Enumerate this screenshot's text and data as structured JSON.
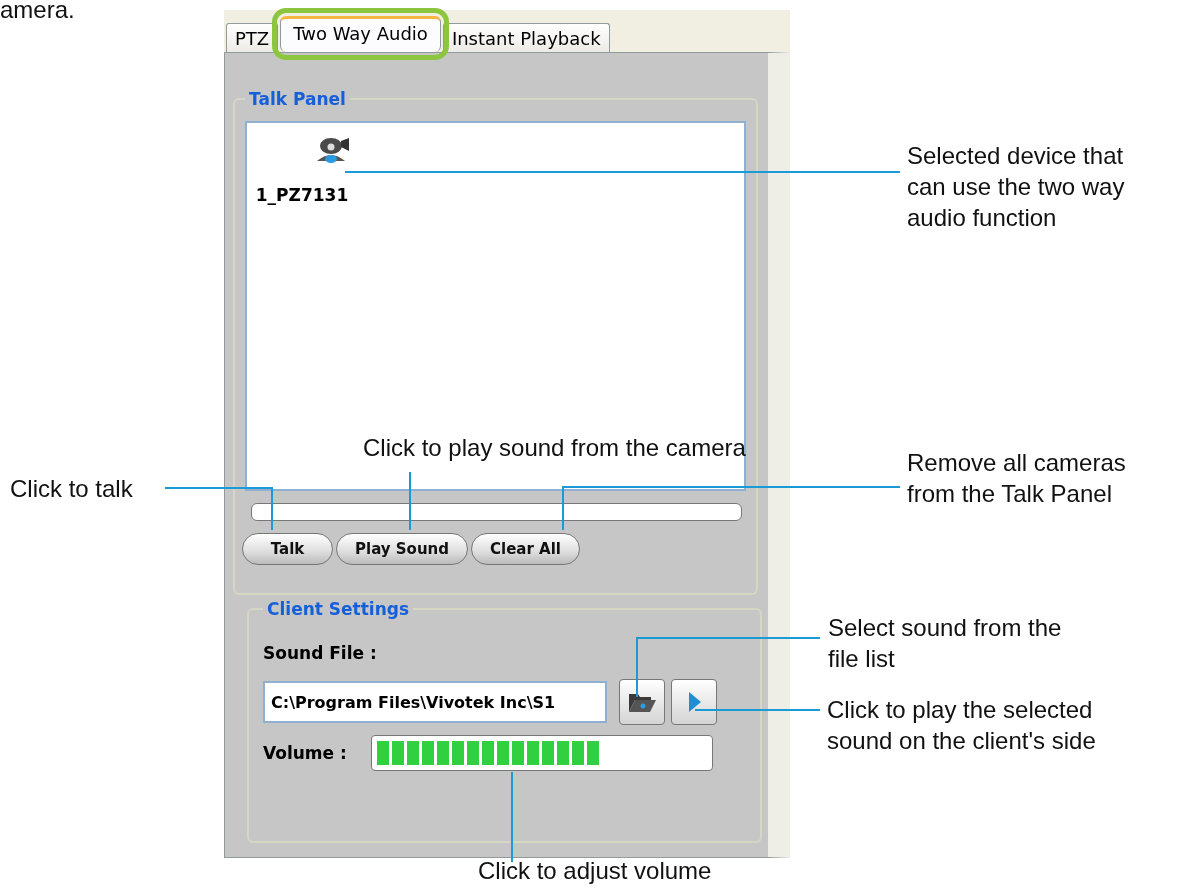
{
  "intro_text": "amera.",
  "tabs": [
    {
      "label": "PTZ",
      "selected": false
    },
    {
      "label": "Two Way Audio",
      "selected": true
    },
    {
      "label": "Instant Playback",
      "selected": false
    }
  ],
  "talk_panel": {
    "title": "Talk Panel",
    "devices": [
      {
        "name": "1_PZ7131"
      }
    ],
    "progress": {
      "level": 0
    },
    "buttons": [
      "Talk",
      "Play Sound",
      "Clear All"
    ]
  },
  "client_settings": {
    "title": "Client Settings",
    "sound_file_label": "Sound File :",
    "sound_file_value": "C:\\Program Files\\Vivotek Inc\\S1",
    "volume_label": "Volume :",
    "volume": {
      "level": 0.68
    }
  },
  "annotations": [
    {
      "text": "Selected device that\ncan use the two way\naudio function"
    },
    {
      "text": "Click to play sound from the camera"
    },
    {
      "text": "Click to talk"
    },
    {
      "text": "Remove all cameras\nfrom the Talk Panel"
    },
    {
      "text": "Select sound from the\nfile list"
    },
    {
      "text": "Click to play the selected\nsound on the client's side"
    },
    {
      "text": "Click to adjust volume"
    }
  ]
}
